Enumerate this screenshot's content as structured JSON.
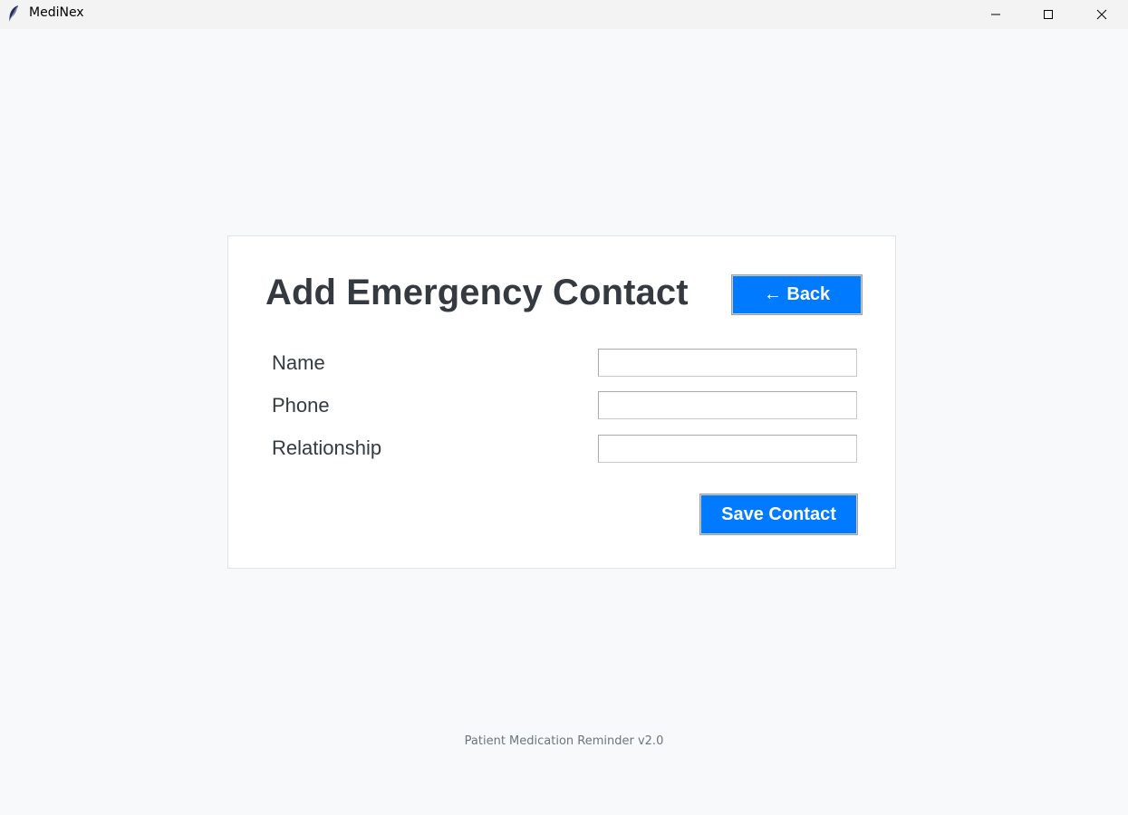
{
  "window": {
    "title": "MediNex",
    "app_icon": "feather-icon"
  },
  "form": {
    "title": "Add Emergency Contact",
    "back_label": "← Back",
    "fields": [
      {
        "label": "Name",
        "value": ""
      },
      {
        "label": "Phone",
        "value": ""
      },
      {
        "label": "Relationship",
        "value": ""
      }
    ],
    "save_label": "Save Contact"
  },
  "footer": {
    "text": "Patient Medication Reminder v2.0"
  },
  "colors": {
    "accent": "#007bff",
    "text": "#343a40",
    "background": "#f8f9fa",
    "footer_text": "#6c757d"
  }
}
